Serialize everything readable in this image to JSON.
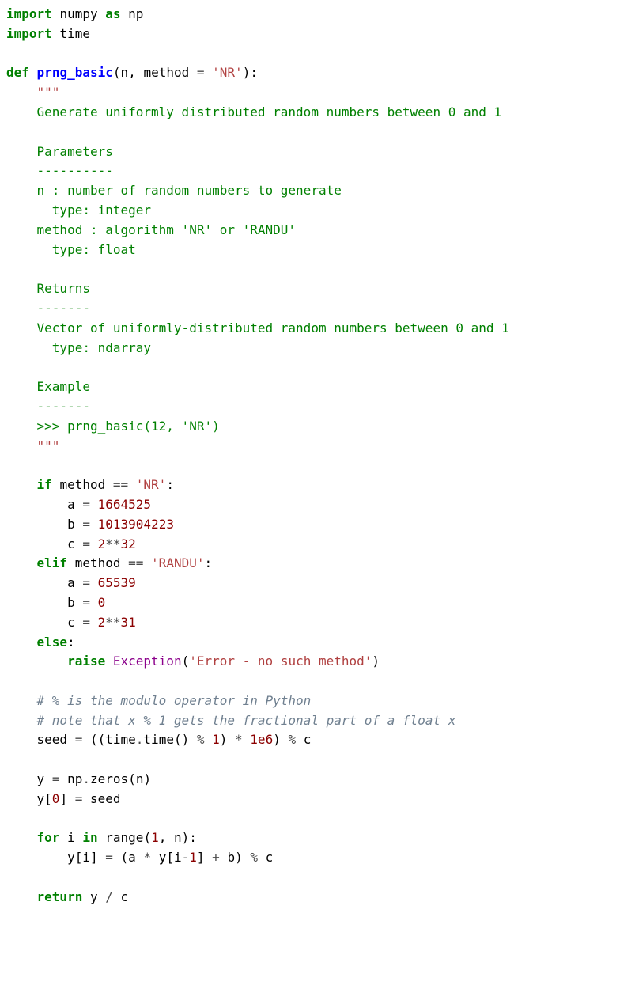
{
  "code": {
    "line1": {
      "kw1": "import",
      "id1": "numpy",
      "kw2": "as",
      "id2": "np"
    },
    "line2": {
      "kw1": "import",
      "id1": "time"
    },
    "line4": {
      "kw1": "def",
      "fn": "prng_basic",
      "lp": "(",
      "p1": "n",
      "c1": ",",
      "p2": "method",
      "eq": "=",
      "str": "'NR'",
      "rp": ")",
      "col": ":"
    },
    "line5": "    \"\"\"",
    "line6": "    Generate uniformly distributed random numbers between 0 and 1",
    "line8": "    Parameters",
    "line9": "    ----------",
    "line10": "    n : number of random numbers to generate",
    "line11": "      type: integer",
    "line12": "    method : algorithm 'NR' or 'RANDU'",
    "line13": "      type: float",
    "line15": "    Returns",
    "line16": "    -------",
    "line17": "    Vector of uniformly-distributed random numbers between 0 and 1",
    "line18": "      type: ndarray",
    "line20": "    Example",
    "line21": "    -------",
    "line22": "    >>> prng_basic(12, 'NR')",
    "line23": "    \"\"\"",
    "if1": {
      "kw": "if",
      "id": "method",
      "op": "==",
      "str": "'NR'",
      "col": ":"
    },
    "a1": {
      "id": "a",
      "eq": "=",
      "num": "1664525"
    },
    "b1": {
      "id": "b",
      "eq": "=",
      "num": "1013904223"
    },
    "c1": {
      "id": "c",
      "eq": "=",
      "num1": "2",
      "op": "**",
      "num2": "32"
    },
    "elif1": {
      "kw": "elif",
      "id": "method",
      "op": "==",
      "str": "'RANDU'",
      "col": ":"
    },
    "a2": {
      "id": "a",
      "eq": "=",
      "num": "65539"
    },
    "b2": {
      "id": "b",
      "eq": "=",
      "num": "0"
    },
    "c2": {
      "id": "c",
      "eq": "=",
      "num1": "2",
      "op": "**",
      "num2": "31"
    },
    "else1": {
      "kw": "else",
      "col": ":"
    },
    "raise1": {
      "kw": "raise",
      "exc": "Exception",
      "lp": "(",
      "str": "'Error - no such method'",
      "rp": ")"
    },
    "cmt1": "    # % is the modulo operator in Python",
    "cmt2": "    # note that x % 1 gets the fractional part of a float x",
    "seed": {
      "id": "seed",
      "eq": "=",
      "lp1": "((",
      "obj": "time",
      "dot": ".",
      "meth": "time",
      "call": "()",
      "mod": " %",
      "one": " 1",
      "rp1": ")",
      "mul": " *",
      "num": "1e6",
      "rp2": ")",
      "mod2": " %",
      "id2": " c"
    },
    "y0": {
      "id": "y",
      "eq": "=",
      "obj": "np",
      "dot": ".",
      "meth": "zeros",
      "lp": "(",
      "arg": "n",
      "rp": ")"
    },
    "y1": {
      "lhs": "y[",
      "idx": "0",
      "rhs": "]",
      "eq": "=",
      "val": "seed"
    },
    "for1": {
      "kw": "for",
      "id": "i",
      "in": "in",
      "fn": "range",
      "lp": "(",
      "a": "1",
      "c": ",",
      "b": "n",
      "rp": ")",
      "col": ":"
    },
    "body": {
      "lhs": "y[i]",
      "eq": "=",
      "lp": "(",
      "a": "a",
      "mul": "*",
      "yim1": "y[i-",
      "one": "1",
      "rb": "]",
      "plus": "+",
      "b": "b",
      "rp": ")",
      "mod": "%",
      "c": "c"
    },
    "ret": {
      "kw": "return",
      "expr": "y",
      "div": "/",
      "c": "c"
    }
  }
}
